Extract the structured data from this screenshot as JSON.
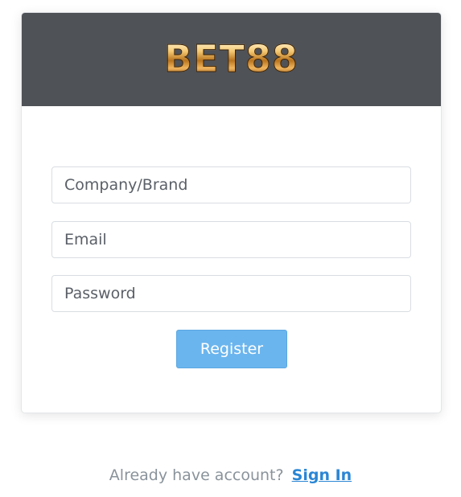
{
  "brand": {
    "logo_text": "BET88"
  },
  "form": {
    "company_placeholder": "Company/Brand",
    "email_placeholder": "Email",
    "password_placeholder": "Password",
    "register_label": "Register"
  },
  "footer": {
    "prompt": "Already have account?",
    "signin_label": "Sign In"
  },
  "colors": {
    "header_bg": "#4f5257",
    "button_bg": "#6bb5ee",
    "link": "#2a86d4"
  }
}
